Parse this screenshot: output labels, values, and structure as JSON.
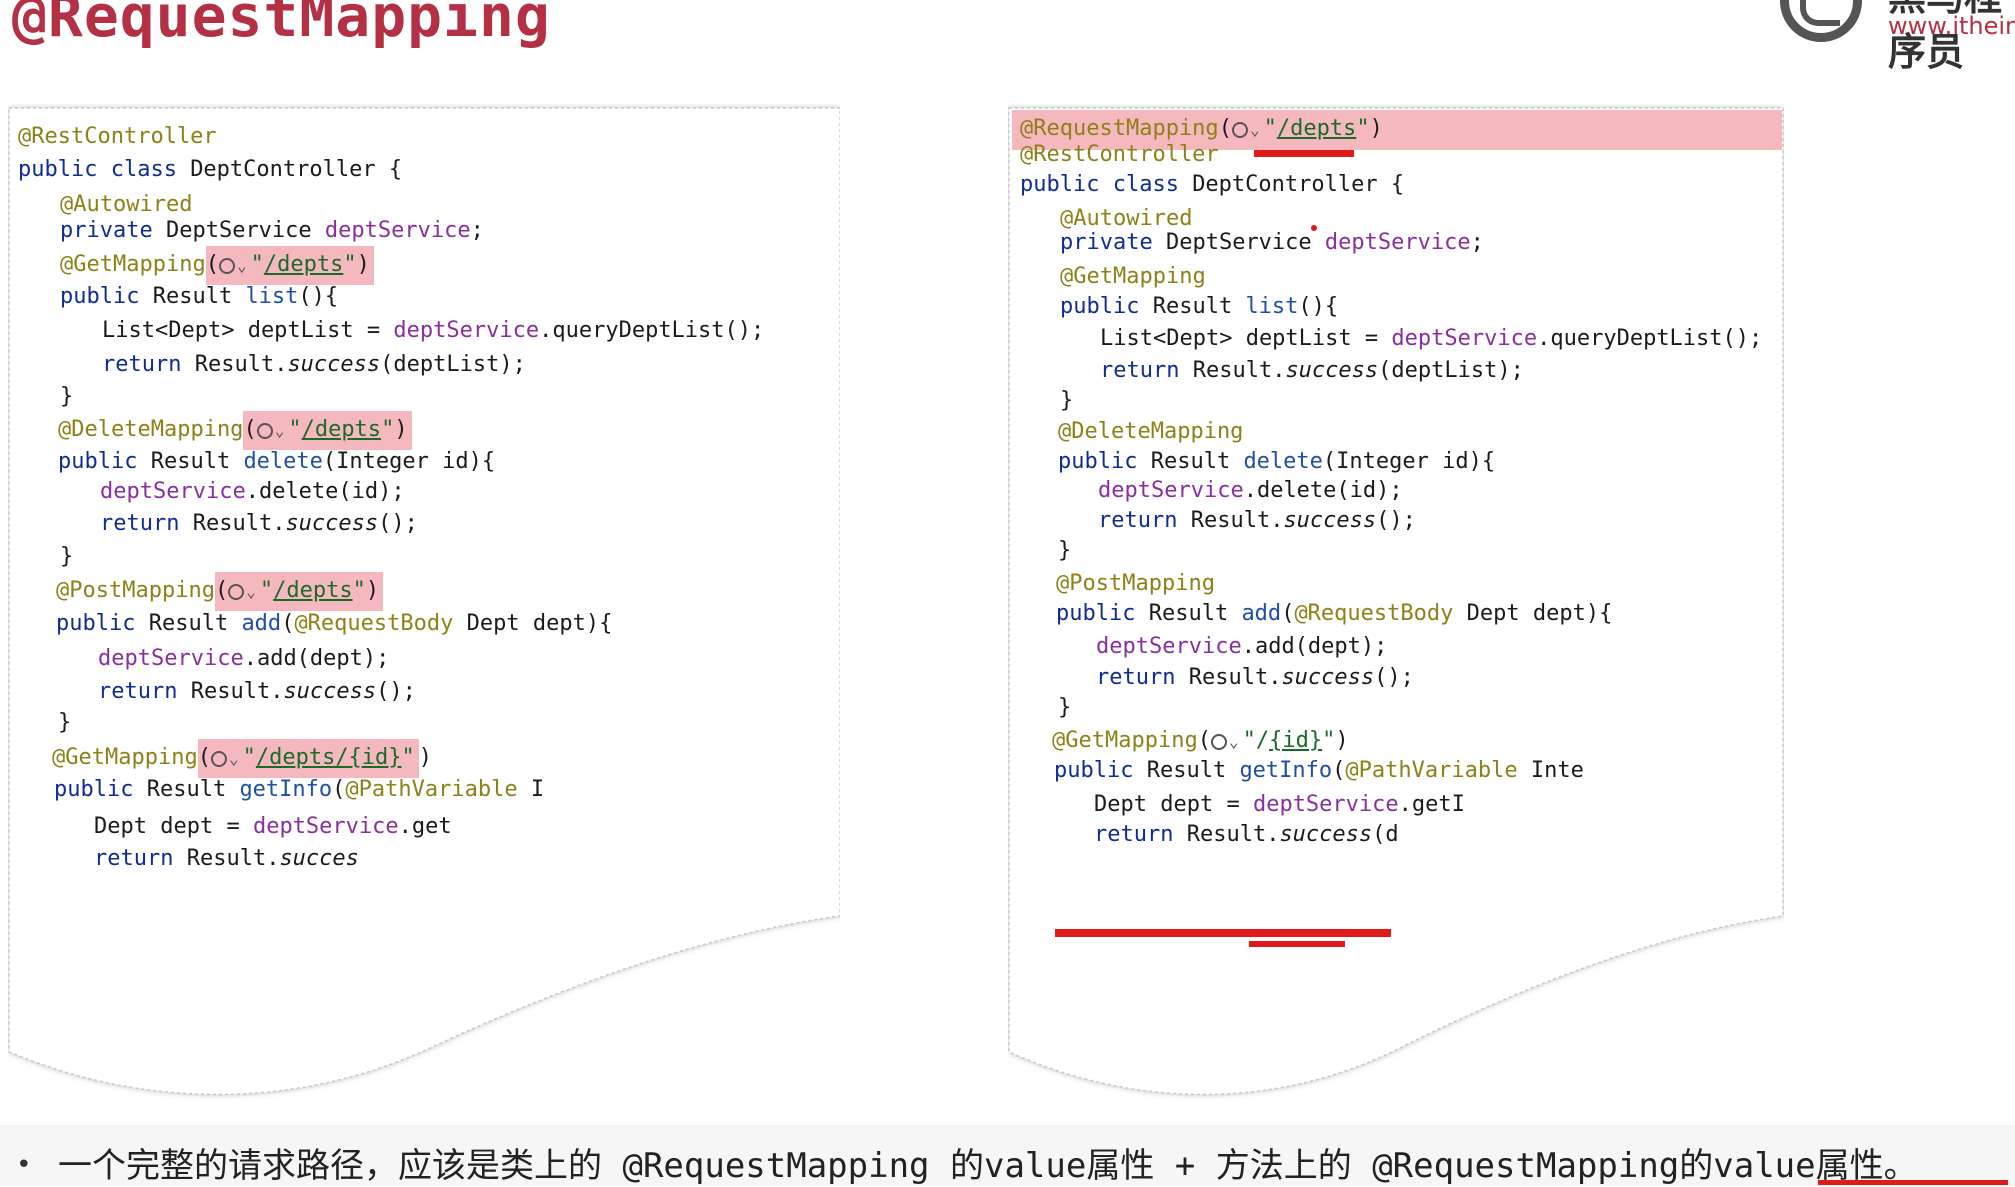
{
  "title": "@RequestMapping",
  "logo": {
    "brand": "黑马程序员",
    "url": "www.itheim"
  },
  "left": {
    "lines": [
      [
        [
          "a",
          "@RestController"
        ]
      ],
      [
        [
          "k",
          "public class "
        ],
        [
          "",
          "DeptController {"
        ]
      ],
      [
        [
          "a",
          "@Autowired"
        ]
      ],
      [
        [
          "k",
          "private "
        ],
        [
          "",
          "DeptService "
        ],
        [
          "f",
          "deptService"
        ],
        [
          "",
          ";"
        ]
      ],
      [
        [
          "a",
          "@GetMapping"
        ],
        [
          "hl-open",
          "("
        ],
        [
          "web",
          ""
        ],
        [
          "chev",
          "⌄"
        ],
        [
          "s",
          "\""
        ],
        [
          "su",
          "/depts"
        ],
        [
          "s",
          "\""
        ],
        [
          "hl-close",
          ")"
        ]
      ],
      [
        [
          "k",
          "public "
        ],
        [
          "",
          "Result "
        ],
        [
          "m",
          "list"
        ],
        [
          "",
          "(){"
        ]
      ],
      [
        [
          "",
          "List<Dept> deptList = "
        ],
        [
          "f",
          "deptService"
        ],
        [
          "",
          ".queryDeptList();"
        ]
      ],
      [
        [
          "k",
          "return "
        ],
        [
          "",
          "Result."
        ],
        [
          "i",
          "success"
        ],
        [
          "",
          "(deptList);"
        ]
      ],
      [
        [
          "",
          "}"
        ]
      ],
      [
        [
          "a",
          "@DeleteMapping"
        ],
        [
          "hl-open",
          "("
        ],
        [
          "web",
          ""
        ],
        [
          "chev",
          "⌄"
        ],
        [
          "s",
          "\""
        ],
        [
          "su",
          "/depts"
        ],
        [
          "s",
          "\""
        ],
        [
          "hl-close",
          ")"
        ]
      ],
      [
        [
          "k",
          "public "
        ],
        [
          "",
          "Result "
        ],
        [
          "m",
          "delete"
        ],
        [
          "",
          "(Integer id){"
        ]
      ],
      [
        [
          "f",
          "deptService"
        ],
        [
          "",
          ".delete(id);"
        ]
      ],
      [
        [
          "k",
          "return "
        ],
        [
          "",
          "Result."
        ],
        [
          "i",
          "success"
        ],
        [
          "",
          "();"
        ]
      ],
      [
        [
          "",
          "}"
        ]
      ],
      [
        [
          "a",
          "@PostMapping"
        ],
        [
          "hl-open",
          "("
        ],
        [
          "web",
          ""
        ],
        [
          "chev",
          "⌄"
        ],
        [
          "s",
          "\""
        ],
        [
          "su",
          "/depts"
        ],
        [
          "s",
          "\""
        ],
        [
          "hl-close",
          ")"
        ]
      ],
      [
        [
          "k",
          "public "
        ],
        [
          "",
          "Result "
        ],
        [
          "m",
          "add"
        ],
        [
          "",
          "("
        ],
        [
          "a",
          "@RequestBody"
        ],
        [
          "",
          " Dept dept){"
        ]
      ],
      [
        [
          "f",
          "deptService"
        ],
        [
          "",
          ".add(dept);"
        ]
      ],
      [
        [
          "k",
          "return "
        ],
        [
          "",
          "Result."
        ],
        [
          "i",
          "success"
        ],
        [
          "",
          "();"
        ]
      ],
      [
        [
          "",
          "}"
        ]
      ],
      [
        [
          "a",
          "@GetMapping"
        ],
        [
          "hl-open",
          "("
        ],
        [
          "web",
          ""
        ],
        [
          "chev",
          "⌄"
        ],
        [
          "s",
          "\""
        ],
        [
          "su",
          "/depts/"
        ],
        [
          "su",
          "{id}"
        ],
        [
          "s",
          "\""
        ],
        [
          "hl-close",
          ""
        ],
        [
          "",
          ")"
        ]
      ],
      [
        [
          "k",
          "public "
        ],
        [
          "",
          "Result "
        ],
        [
          "m",
          "getInfo"
        ],
        [
          "",
          "("
        ],
        [
          "a",
          "@PathVariable"
        ],
        [
          "",
          " I"
        ]
      ],
      [
        [
          "",
          "Dept dept = "
        ],
        [
          "f",
          "deptService"
        ],
        [
          "",
          ".get"
        ]
      ],
      [
        [
          "k",
          "return "
        ],
        [
          "",
          "Result."
        ],
        [
          "i",
          "succes"
        ]
      ]
    ]
  },
  "right": {
    "lines": [
      [
        [
          "a",
          "@RequestMapping"
        ],
        [
          "",
          "("
        ],
        [
          "web",
          ""
        ],
        [
          "chev",
          "⌄"
        ],
        [
          "s",
          "\""
        ],
        [
          "su",
          "/depts"
        ],
        [
          "s",
          "\""
        ],
        [
          "",
          ")"
        ]
      ],
      [
        [
          "a",
          "@RestController"
        ]
      ],
      [
        [
          "k",
          "public class "
        ],
        [
          "",
          "DeptController {"
        ]
      ],
      [
        [
          "a",
          "@Autowired"
        ]
      ],
      [
        [
          "k",
          "private "
        ],
        [
          "",
          "DeptService "
        ],
        [
          "f",
          "deptService"
        ],
        [
          "",
          ";"
        ]
      ],
      [
        [
          "a",
          "@GetMapping"
        ]
      ],
      [
        [
          "k",
          "public "
        ],
        [
          "",
          "Result "
        ],
        [
          "m",
          "list"
        ],
        [
          "",
          "(){"
        ]
      ],
      [
        [
          "",
          "List<Dept> deptList = "
        ],
        [
          "f",
          "deptService"
        ],
        [
          "",
          ".queryDeptList();"
        ]
      ],
      [
        [
          "k",
          "return "
        ],
        [
          "",
          "Result."
        ],
        [
          "i",
          "success"
        ],
        [
          "",
          "(deptList);"
        ]
      ],
      [
        [
          "",
          "}"
        ]
      ],
      [
        [
          "a",
          "@DeleteMapping"
        ]
      ],
      [
        [
          "k",
          "public "
        ],
        [
          "",
          "Result "
        ],
        [
          "m",
          "delete"
        ],
        [
          "",
          "(Integer id){"
        ]
      ],
      [
        [
          "f",
          "deptService"
        ],
        [
          "",
          ".delete(id);"
        ]
      ],
      [
        [
          "k",
          "return "
        ],
        [
          "",
          "Result."
        ],
        [
          "i",
          "success"
        ],
        [
          "",
          "();"
        ]
      ],
      [
        [
          "",
          "}"
        ]
      ],
      [
        [
          "a",
          "@PostMapping"
        ]
      ],
      [
        [
          "k",
          "public "
        ],
        [
          "",
          "Result "
        ],
        [
          "m",
          "add"
        ],
        [
          "",
          "("
        ],
        [
          "a",
          "@RequestBody"
        ],
        [
          "",
          " Dept dept){"
        ]
      ],
      [
        [
          "f",
          "deptService"
        ],
        [
          "",
          ".add(dept);"
        ]
      ],
      [
        [
          "k",
          "return "
        ],
        [
          "",
          "Result."
        ],
        [
          "i",
          "success"
        ],
        [
          "",
          "();"
        ]
      ],
      [
        [
          "",
          "}"
        ]
      ],
      [
        [
          "a",
          "@GetMapping"
        ],
        [
          "",
          "("
        ],
        [
          "web",
          ""
        ],
        [
          "chev",
          "⌄"
        ],
        [
          "s",
          "\"/"
        ],
        [
          "su",
          "{id}"
        ],
        [
          "s",
          "\""
        ],
        [
          "",
          ")"
        ]
      ],
      [
        [
          "k",
          "public "
        ],
        [
          "",
          "Result "
        ],
        [
          "m",
          "getInfo"
        ],
        [
          "",
          "("
        ],
        [
          "a",
          "@PathVariable"
        ],
        [
          "",
          " Inte"
        ]
      ],
      [
        [
          "",
          "Dept dept = "
        ],
        [
          "f",
          "deptService"
        ],
        [
          "",
          ".getI"
        ]
      ],
      [
        [
          "k",
          "return "
        ],
        [
          "",
          "Result."
        ],
        [
          "i",
          "success"
        ],
        [
          "",
          "(d"
        ]
      ]
    ]
  },
  "footer": {
    "bullet": "•",
    "text": "一个完整的请求路径，应该是类上的 @RequestMapping 的value属性 + 方法上的 @RequestMapping的value属性。"
  }
}
